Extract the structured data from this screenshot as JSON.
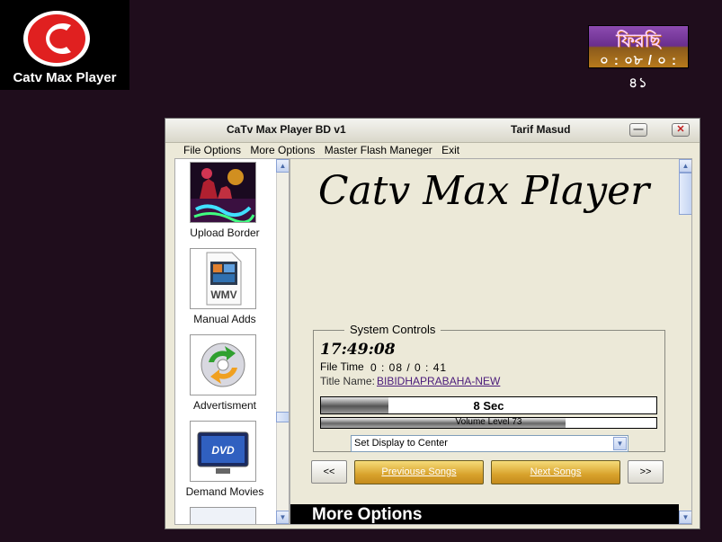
{
  "logo": {
    "text": "Catv Max Player",
    "brand_color": "#e02020"
  },
  "badge": {
    "line1": "ফিরছি",
    "line2": "০ : ০৮ / ০ : ৪১"
  },
  "window": {
    "title": "CaTv Max Player BD  v1",
    "user": "Tarif Masud",
    "minimize_glyph": "—",
    "close_glyph": "✕"
  },
  "menu": [
    "File Options",
    "More Options",
    "Master Flash Maneger",
    "Exit"
  ],
  "tiles": [
    {
      "label": "Upload Border",
      "icon": "fireworks-icon"
    },
    {
      "label": "Manual Adds",
      "icon": "wmv-file-icon",
      "badge": "WMV"
    },
    {
      "label": "Advertisment",
      "icon": "refresh-disc-icon"
    },
    {
      "label": "Demand Movies",
      "icon": "dvd-display-icon",
      "badge": "DVD"
    }
  ],
  "main": {
    "title": "Catv Max Player",
    "system_controls": {
      "legend": "System Controls",
      "clock": "17:49:08",
      "file_time_label": "File Time",
      "file_time_value": "0 : 08 / 0 : 41",
      "title_name_label": "Title Name:",
      "title_name_value": "BIBIDHAPRABAHA-NEW",
      "countdown_text": "8  Sec",
      "countdown_fraction": 0.2,
      "volume_text": "Volume Level  73",
      "volume_fraction": 0.73,
      "display_select": "Set Display to Center"
    },
    "nav": {
      "prev_small": "<<",
      "prev_songs": "Previouse Songs",
      "next_songs": "Next Songs",
      "next_small": ">>"
    },
    "more_options": "More Options"
  }
}
